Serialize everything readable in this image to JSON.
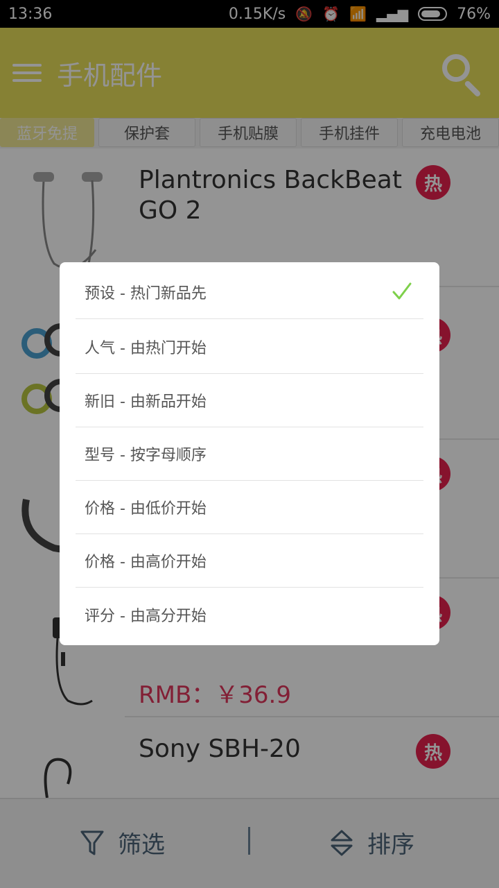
{
  "status_bar": {
    "time": "13:36",
    "net_speed": "0.15K/s",
    "battery": "76%"
  },
  "toolbar": {
    "title": "手机配件"
  },
  "tabs": [
    {
      "label": "蓝牙免提",
      "active": true
    },
    {
      "label": "保护套"
    },
    {
      "label": "手机贴膜"
    },
    {
      "label": "手机挂件"
    },
    {
      "label": "充电电池"
    }
  ],
  "products": [
    {
      "name": "Plantronics BackBeat GO 2",
      "price": "",
      "hot": "热"
    },
    {
      "name": "",
      "price": "",
      "hot": "热"
    },
    {
      "name": "",
      "price": "",
      "hot": "热"
    },
    {
      "name": "",
      "price": "RMB：￥36.9",
      "hot": "热"
    },
    {
      "name": "Sony SBH-20",
      "price": "",
      "hot": "热"
    }
  ],
  "bottom_bar": {
    "filter_label": "筛选",
    "sort_label": "排序"
  },
  "sort_dialog": {
    "options": [
      {
        "label": "预设 - 热门新品先",
        "selected": true
      },
      {
        "label": "人气 - 由热门开始"
      },
      {
        "label": "新旧 - 由新品开始"
      },
      {
        "label": "型号 - 按字母顺序"
      },
      {
        "label": "价格 - 由低价开始"
      },
      {
        "label": "价格 - 由高价开始"
      },
      {
        "label": "评分 - 由高分开始"
      }
    ]
  },
  "colors": {
    "toolbar": "#e7de5a",
    "hot_badge": "#e7224e",
    "price": "#e0365c",
    "check": "#7ed04b"
  }
}
